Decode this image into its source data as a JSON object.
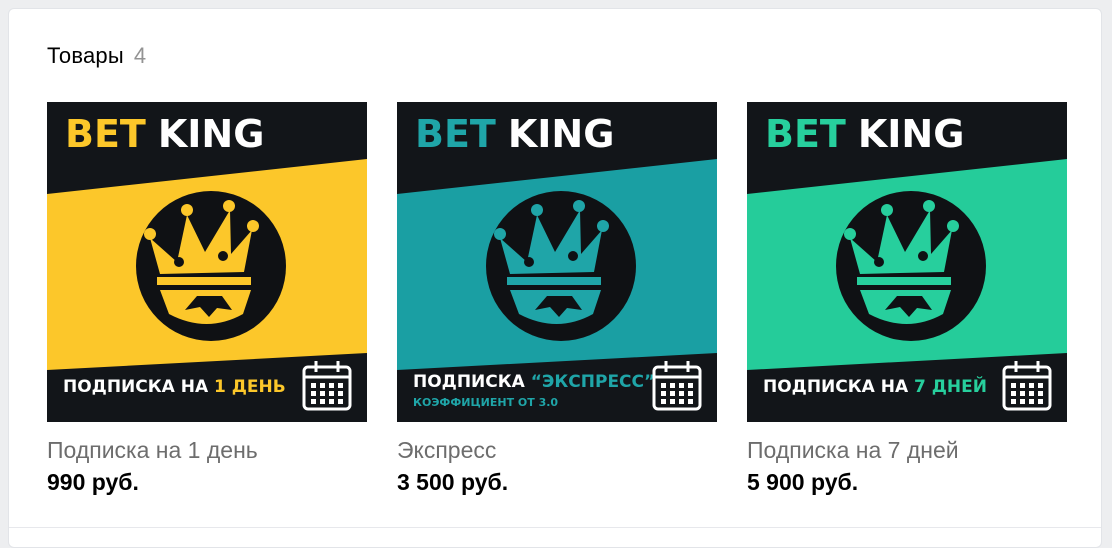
{
  "section": {
    "title": "Товары",
    "count": "4"
  },
  "products": [
    {
      "name": "Подписка на 1 день",
      "price": "990 руб.",
      "image": {
        "brand_a": "BET",
        "brand_b": "KING",
        "caption_main": "ПОДПИСКА НА ",
        "caption_accent": "1 ДЕНЬ",
        "caption_sub": "",
        "accent": "#fcc72a",
        "band": "#fcc72a",
        "icon": "calendar-icon"
      }
    },
    {
      "name": "Экспресс",
      "price": "3 500 руб.",
      "image": {
        "brand_a": "BET",
        "brand_b": "KING",
        "caption_main": "ПОДПИСКА ",
        "caption_accent": "“ЭКСПРЕСС”",
        "caption_sub": "КОЭФФИЦИЕНТ ОТ 3.0",
        "accent": "#1fa5a8",
        "band": "#1a9fa3",
        "icon": "calendar-icon"
      }
    },
    {
      "name": "Подписка на 7 дней",
      "price": "5 900 руб.",
      "image": {
        "brand_a": "BET",
        "brand_b": "KING",
        "caption_main": "ПОДПИСКА НА ",
        "caption_accent": "7 ДНЕЙ",
        "caption_sub": "",
        "accent": "#27cf9d",
        "band": "#25cc9a",
        "icon": "calendar-icon"
      }
    }
  ]
}
